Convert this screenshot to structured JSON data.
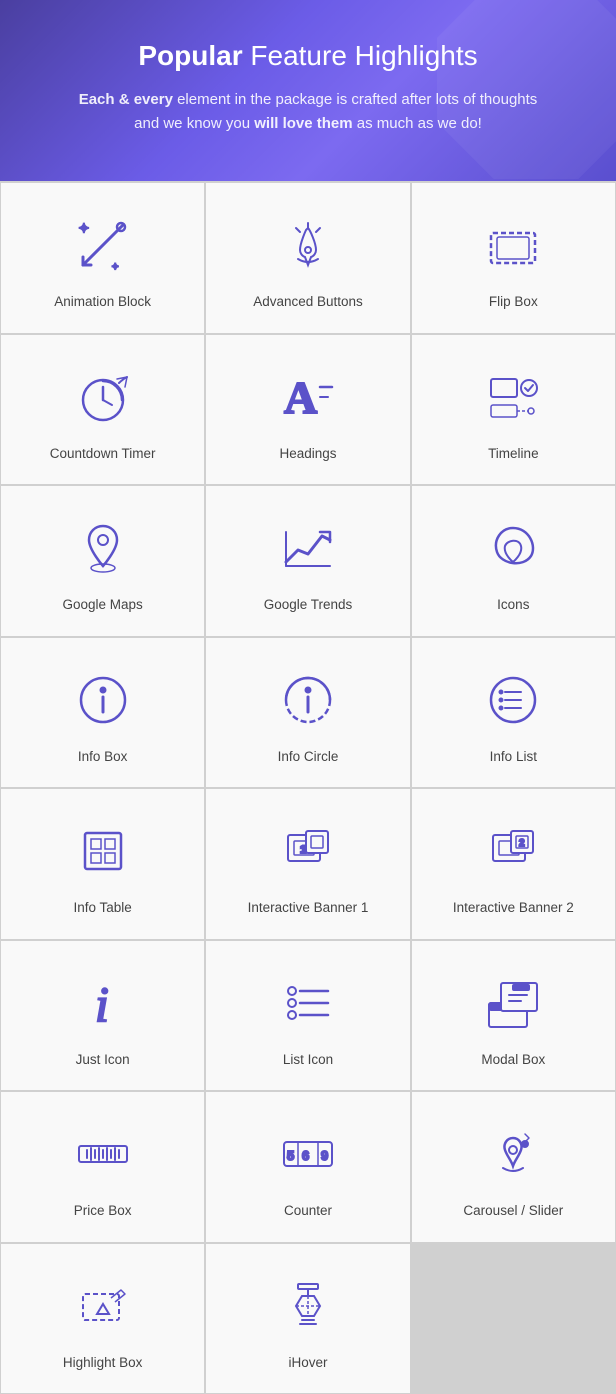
{
  "header": {
    "title_normal": "Popular ",
    "title_bold": "Feature Highlights",
    "subtitle_line1_normal": "Each & every",
    "subtitle_line1_rest": " element in the package is crafted after lots of thoughts",
    "subtitle_line2_normal": "and we know you ",
    "subtitle_line2_bold": "will love them",
    "subtitle_line2_rest": " as much as we do!"
  },
  "items": [
    {
      "id": "animation-block",
      "label": "Animation Block"
    },
    {
      "id": "advanced-buttons",
      "label": "Advanced Buttons"
    },
    {
      "id": "flip-box",
      "label": "Flip Box"
    },
    {
      "id": "countdown-timer",
      "label": "Countdown Timer"
    },
    {
      "id": "headings",
      "label": "Headings"
    },
    {
      "id": "timeline",
      "label": "Timeline"
    },
    {
      "id": "google-maps",
      "label": "Google Maps"
    },
    {
      "id": "google-trends",
      "label": "Google Trends"
    },
    {
      "id": "icons",
      "label": "Icons"
    },
    {
      "id": "info-box",
      "label": "Info Box"
    },
    {
      "id": "info-circle",
      "label": "Info Circle"
    },
    {
      "id": "info-list",
      "label": "Info List"
    },
    {
      "id": "info-table",
      "label": "Info Table"
    },
    {
      "id": "interactive-banner-1",
      "label": "Interactive Banner 1"
    },
    {
      "id": "interactive-banner-2",
      "label": "Interactive Banner 2"
    },
    {
      "id": "just-icon",
      "label": "Just Icon"
    },
    {
      "id": "list-icon",
      "label": "List Icon"
    },
    {
      "id": "modal-box",
      "label": "Modal Box"
    },
    {
      "id": "price-box",
      "label": "Price Box"
    },
    {
      "id": "counter",
      "label": "Counter"
    },
    {
      "id": "carousel-slider",
      "label": "Carousel / Slider"
    },
    {
      "id": "highlight-box",
      "label": "Highlight Box"
    },
    {
      "id": "ihover",
      "label": "iHover"
    }
  ]
}
